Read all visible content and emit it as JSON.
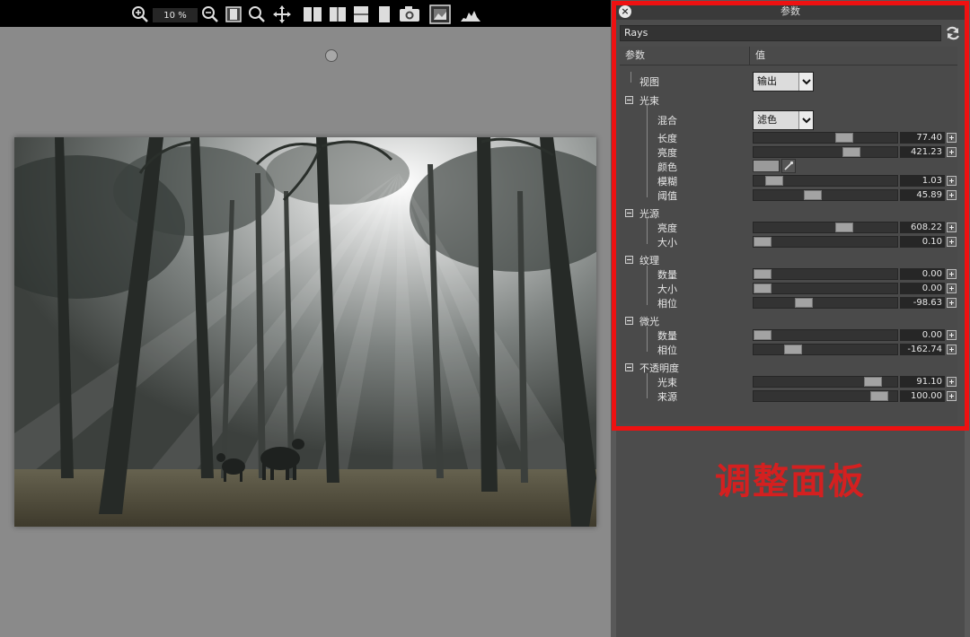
{
  "toolbar": {
    "zoom_value": "10 %",
    "tools": [
      {
        "name": "zoom-in-icon"
      },
      {
        "name": "zoom-out-icon"
      },
      {
        "name": "fit-icon"
      },
      {
        "name": "zoom-icon"
      },
      {
        "name": "pan-icon"
      },
      {
        "name": "split-view-icon"
      },
      {
        "name": "split-vertical-icon"
      },
      {
        "name": "split-horizontal-icon"
      },
      {
        "name": "single-view-icon"
      },
      {
        "name": "snapshot-icon"
      },
      {
        "name": "image-icon"
      },
      {
        "name": "histogram-icon"
      }
    ]
  },
  "panel": {
    "title": "参数",
    "filter_name": "Rays",
    "col_param": "参数",
    "col_value": "值",
    "rows": [
      {
        "label": "视图",
        "type": "dropdown",
        "value": "输出"
      },
      {
        "label": "光束",
        "type": "group"
      },
      {
        "label": "混合",
        "type": "dropdown",
        "value": "滤色"
      },
      {
        "label": "长度",
        "type": "slider",
        "value": "77.40",
        "pos": 0.65
      },
      {
        "label": "亮度",
        "type": "slider",
        "value": "421.23",
        "pos": 0.71
      },
      {
        "label": "颜色",
        "type": "color"
      },
      {
        "label": "模糊",
        "type": "slider",
        "value": "1.03",
        "pos": 0.09
      },
      {
        "label": "阈值",
        "type": "slider",
        "value": "45.89",
        "pos": 0.4
      },
      {
        "label": "光源",
        "type": "group"
      },
      {
        "label": "亮度",
        "type": "slider",
        "value": "608.22",
        "pos": 0.65
      },
      {
        "label": "大小",
        "type": "slider",
        "value": "0.10",
        "pos": 0.0
      },
      {
        "label": "纹理",
        "type": "group"
      },
      {
        "label": "数量",
        "type": "slider",
        "value": "0.00",
        "pos": 0.0
      },
      {
        "label": "大小",
        "type": "slider",
        "value": "0.00",
        "pos": 0.0
      },
      {
        "label": "相位",
        "type": "slider",
        "value": "-98.63",
        "pos": 0.33
      },
      {
        "label": "微光",
        "type": "group"
      },
      {
        "label": "数量",
        "type": "slider",
        "value": "0.00",
        "pos": 0.0
      },
      {
        "label": "相位",
        "type": "slider",
        "value": "-162.74",
        "pos": 0.24
      },
      {
        "label": "不透明度",
        "type": "group"
      },
      {
        "label": "光束",
        "type": "slider",
        "value": "91.10",
        "pos": 0.88
      },
      {
        "label": "来源",
        "type": "slider",
        "value": "100.00",
        "pos": 0.93
      }
    ]
  },
  "caption": "调整面板",
  "colors": {
    "accent_red": "#ee1111",
    "caption_red": "#d42020",
    "panel_bg": "#4c4c4c",
    "canvas_bg": "#8a8a8a"
  }
}
